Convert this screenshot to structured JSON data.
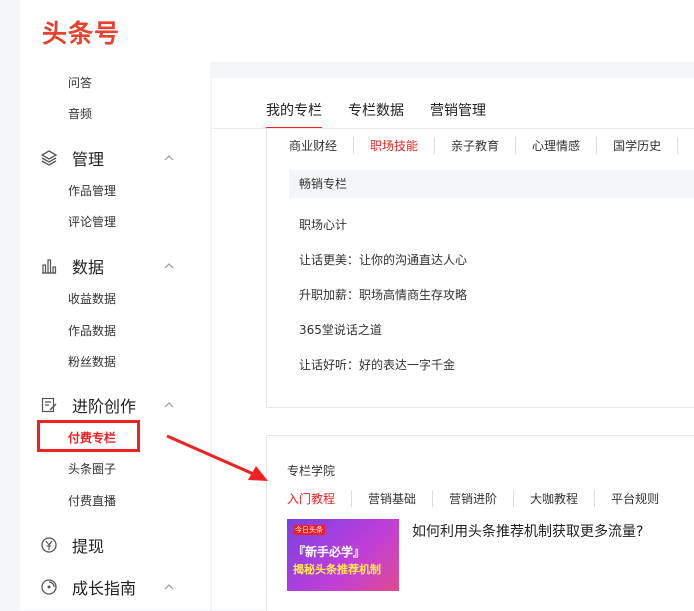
{
  "app": {
    "logo": "头条号"
  },
  "sidebar": {
    "top_items": [
      {
        "label": "问答"
      },
      {
        "label": "音频"
      }
    ],
    "groups": {
      "manage": {
        "label": "管理",
        "icon": "layers-icon",
        "items": [
          {
            "label": "作品管理"
          },
          {
            "label": "评论管理"
          }
        ]
      },
      "data": {
        "label": "数据",
        "icon": "bar-chart-icon",
        "items": [
          {
            "label": "收益数据"
          },
          {
            "label": "作品数据"
          },
          {
            "label": "粉丝数据"
          }
        ]
      },
      "create": {
        "label": "进阶创作",
        "icon": "edit-icon",
        "items": [
          {
            "label": "付费专栏",
            "active": true
          },
          {
            "label": "头条圈子"
          },
          {
            "label": "付费直播"
          }
        ]
      },
      "withdraw": {
        "label": "提现",
        "icon": "yen-circle-icon"
      },
      "growth": {
        "label": "成长指南",
        "icon": "compass-icon"
      }
    }
  },
  "main": {
    "tabs": [
      {
        "label": "我的专栏",
        "active": true
      },
      {
        "label": "专栏数据"
      },
      {
        "label": "营销管理"
      }
    ],
    "categories": [
      {
        "label": "商业财经"
      },
      {
        "label": "职场技能",
        "active": true
      },
      {
        "label": "亲子教育"
      },
      {
        "label": "心理情感"
      },
      {
        "label": "国学历史"
      }
    ],
    "hot_label": "畅销专栏",
    "recommendations": [
      "职场心计",
      "让话更美：让你的沟通直达人心",
      "升职加薪：职场高情商生存攻略",
      "365堂说话之道",
      "让话好听：好的表达一字千金"
    ],
    "academy": {
      "title": "专栏学院",
      "tabs": [
        {
          "label": "入门教程",
          "active": true
        },
        {
          "label": "营销基础"
        },
        {
          "label": "营销进阶"
        },
        {
          "label": "大咖教程"
        },
        {
          "label": "平台规则"
        }
      ],
      "thumb": {
        "brand": "今日头条",
        "line1": "『新手必学』",
        "line2": "揭秘头条推荐机制"
      },
      "article_title": "如何利用头条推荐机制获取更多流量?"
    }
  },
  "colors": {
    "accent": "#e22222",
    "logo": "#e8412f"
  }
}
